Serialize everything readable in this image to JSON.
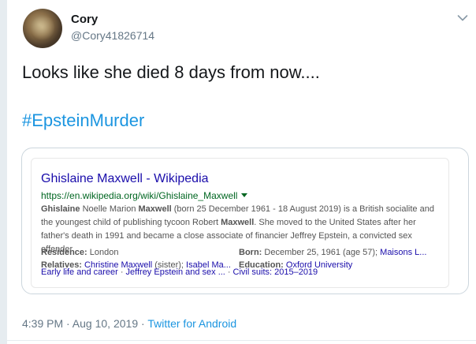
{
  "tweet": {
    "author_name": "Cory",
    "author_handle": "@Cory41826714",
    "text": "Looks like she died 8 days from now....",
    "hashtag": "#EpsteinMurder",
    "timestamp": "4:39 PM · Aug 10, 2019",
    "dot_separator": " · ",
    "client": "Twitter for Android"
  },
  "card": {
    "title": "Ghislaine Maxwell - Wikipedia",
    "url": "https://en.wikipedia.org/wiki/Ghislaine_Maxwell",
    "snippet": {
      "lead_bold": "Ghislaine",
      "lead_rest": " Noelle Marion ",
      "maxwell1": "Maxwell",
      "line1_rest": " (born 25 December 1961 - 18 August 2019) is a British socialite and the youngest child of publishing tycoon Robert ",
      "maxwell2": "Maxwell",
      "rest": ". She moved to the United States after her father's death in 1991 and became a close associate of financier Jeffrey Epstein, a convicted sex offender."
    },
    "facts": {
      "residence_label": "Residence:",
      "residence_value": "London",
      "born_label": "Born:",
      "born_value": "December 25, 1961 (age 57);",
      "born_link": "Maisons L...",
      "relatives_label": "Relatives:",
      "relatives_link1": "Christine Maxwell",
      "relatives_mid": " (sister); ",
      "relatives_link2": "Isabel Ma...",
      "education_label": "Education:",
      "education_link": "Oxford University"
    },
    "sitelinks": [
      "Early life and career",
      "Jeffrey Epstein and sex ...",
      "Civil suits: 2015–2019"
    ],
    "sitelink_separator": "·"
  },
  "colors": {
    "link_blue": "#1b95e0",
    "google_title": "#1a0dab",
    "google_url": "#006621",
    "secondary_text": "#657786"
  },
  "icons": {
    "more_menu": "chevron-down-icon",
    "url_dropdown": "caret-down-icon"
  }
}
